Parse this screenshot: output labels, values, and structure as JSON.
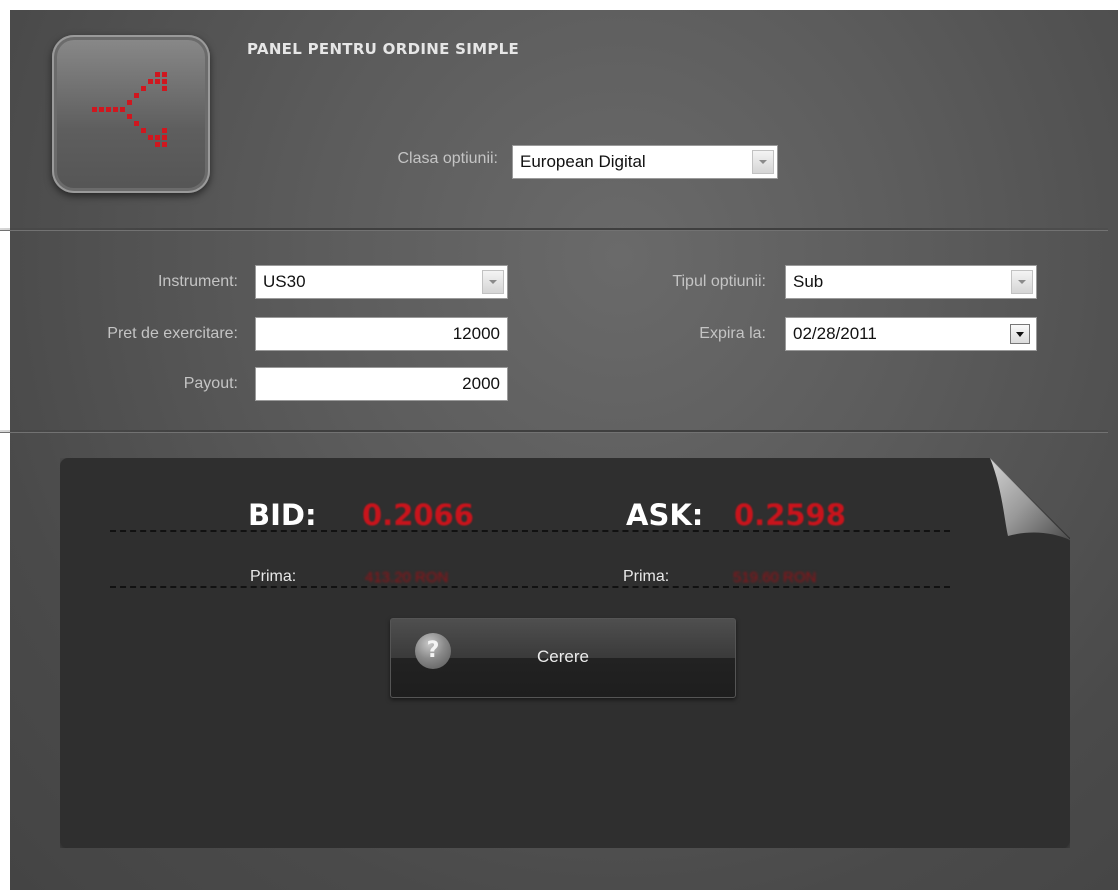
{
  "header": {
    "title": "PANEL PENTRU ORDINE SIMPLE",
    "icon": "split-arrows-icon",
    "accent_color": "#d0171f"
  },
  "option_class": {
    "label": "Clasa optiunii:",
    "value": "European Digital"
  },
  "form": {
    "instrument": {
      "label": "Instrument:",
      "value": "US30"
    },
    "strike_price": {
      "label": "Pret de exercitare:",
      "value": "12000"
    },
    "payout": {
      "label": "Payout:",
      "value": "2000"
    },
    "option_type": {
      "label": "Tipul optiunii:",
      "value": "Sub"
    },
    "expiry": {
      "label": "Expira la:",
      "value": "02/28/2011"
    }
  },
  "quotes": {
    "bid": {
      "label": "BID:",
      "value": "0.2066",
      "premium_label": "Prima:",
      "premium_value": "413.20 RON"
    },
    "ask": {
      "label": "ASK:",
      "value": "0.2598",
      "premium_label": "Prima:",
      "premium_value": "519.60 RON"
    },
    "value_color": "#c8141c"
  },
  "actions": {
    "request_label": "Cerere",
    "help_icon": "question-icon",
    "help_glyph": "?"
  }
}
